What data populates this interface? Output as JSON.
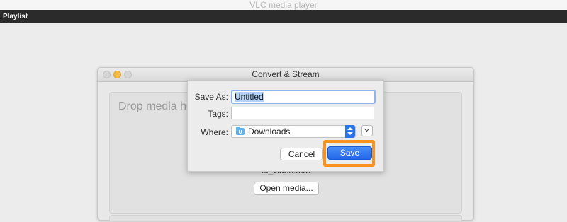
{
  "app": {
    "title": "VLC media player"
  },
  "playlist": {
    "label": "Playlist"
  },
  "convert_window": {
    "title": "Convert & Stream",
    "drop_text": "Drop media here",
    "file_name": "4k_video.mov",
    "open_media_label": "Open media..."
  },
  "save_dialog": {
    "save_as_label": "Save As:",
    "save_as_value": "Untitled",
    "tags_label": "Tags:",
    "tags_value": "",
    "where_label": "Where:",
    "where_value": "Downloads",
    "cancel_label": "Cancel",
    "save_label": "Save"
  },
  "colors": {
    "highlight": "#f7921e",
    "accent": "#2b74ee",
    "playlist_bar": "#2b2b2b"
  }
}
